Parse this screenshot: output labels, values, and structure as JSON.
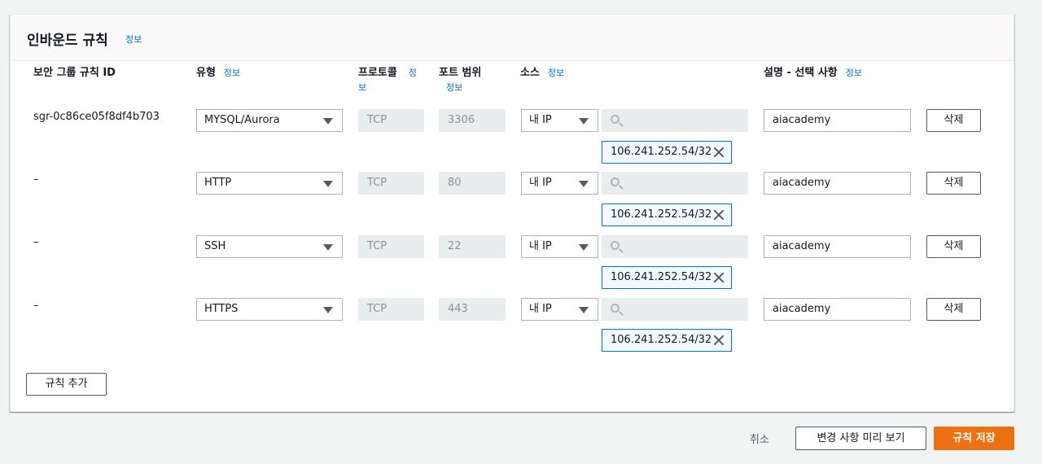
{
  "panel": {
    "title": "인바운드 규칙",
    "info": "정보"
  },
  "columns": {
    "rule_id": "보안 그룹 규칙 ID",
    "type": "유형",
    "type_info": "정보",
    "protocol_line1": "프로토콜",
    "protocol_info_a": "정",
    "protocol_info_b": "보",
    "port_range": "포트 범위",
    "port_info": "정보",
    "source": "소스",
    "source_info": "정보",
    "description": "설명 - 선택 사항",
    "description_info": "정보"
  },
  "rules": [
    {
      "id": "sgr-0c86ce05f8df4b703",
      "type": "MYSQL/Aurora",
      "protocol": "TCP",
      "port": "3306",
      "source_type": "내 IP",
      "cidr": "106.241.252.54/32",
      "description": "aiacademy",
      "delete": "삭제"
    },
    {
      "id": "–",
      "type": "HTTP",
      "protocol": "TCP",
      "port": "80",
      "source_type": "내 IP",
      "cidr": "106.241.252.54/32",
      "description": "aiacademy",
      "delete": "삭제"
    },
    {
      "id": "–",
      "type": "SSH",
      "protocol": "TCP",
      "port": "22",
      "source_type": "내 IP",
      "cidr": "106.241.252.54/32",
      "description": "aiacademy",
      "delete": "삭제"
    },
    {
      "id": "–",
      "type": "HTTPS",
      "protocol": "TCP",
      "port": "443",
      "source_type": "내 IP",
      "cidr": "106.241.252.54/32",
      "description": "aiacademy",
      "delete": "삭제"
    }
  ],
  "add_rule": "규칙 추가",
  "footer": {
    "cancel": "취소",
    "preview": "변경 사항 미리 보기",
    "save": "규칙 저장"
  },
  "colors": {
    "primary": "#ec7211",
    "link": "#0073bb",
    "token_border": "#0073bb"
  }
}
